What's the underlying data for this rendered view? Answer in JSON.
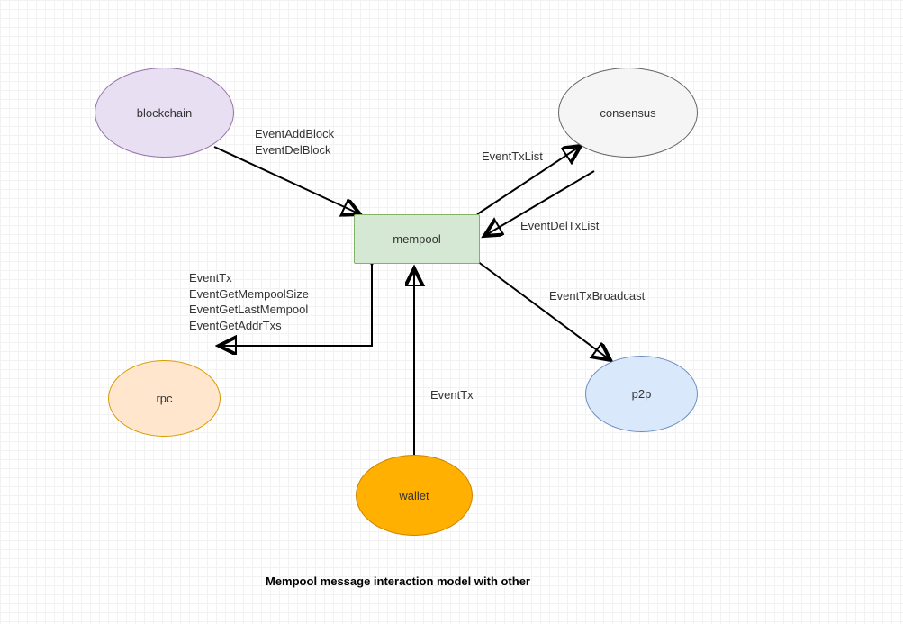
{
  "nodes": {
    "blockchain": {
      "label": "blockchain",
      "fill": "#e8dff2",
      "stroke": "#9673a6"
    },
    "consensus": {
      "label": "consensus",
      "fill": "#f5f5f5",
      "stroke": "#666666"
    },
    "mempool": {
      "label": "mempool",
      "fill": "#d5e8d4",
      "stroke": "#82b366"
    },
    "rpc": {
      "label": "rpc",
      "fill": "#ffe6cc",
      "stroke": "#d79b00"
    },
    "p2p": {
      "label": "p2p",
      "fill": "#dae8fc",
      "stroke": "#6c8ebf"
    },
    "wallet": {
      "label": "wallet",
      "fill": "#ffb000",
      "stroke": "#cc8400"
    }
  },
  "edges": {
    "blockchain_to_mempool": {
      "lines": [
        "EventAddBlock",
        "EventDelBlock"
      ]
    },
    "mempool_to_consensus": {
      "lines": [
        "EventTxList"
      ]
    },
    "consensus_to_mempool": {
      "lines": [
        "EventDelTxList"
      ]
    },
    "mempool_to_rpc": {
      "lines": [
        "EventTx",
        "EventGetMempoolSize",
        "EventGetLastMempool",
        "EventGetAddrTxs"
      ]
    },
    "wallet_to_mempool": {
      "lines": [
        "EventTx"
      ]
    },
    "mempool_to_p2p": {
      "lines": [
        "EventTxBroadcast"
      ]
    }
  },
  "caption": "Mempool message interaction model with other"
}
